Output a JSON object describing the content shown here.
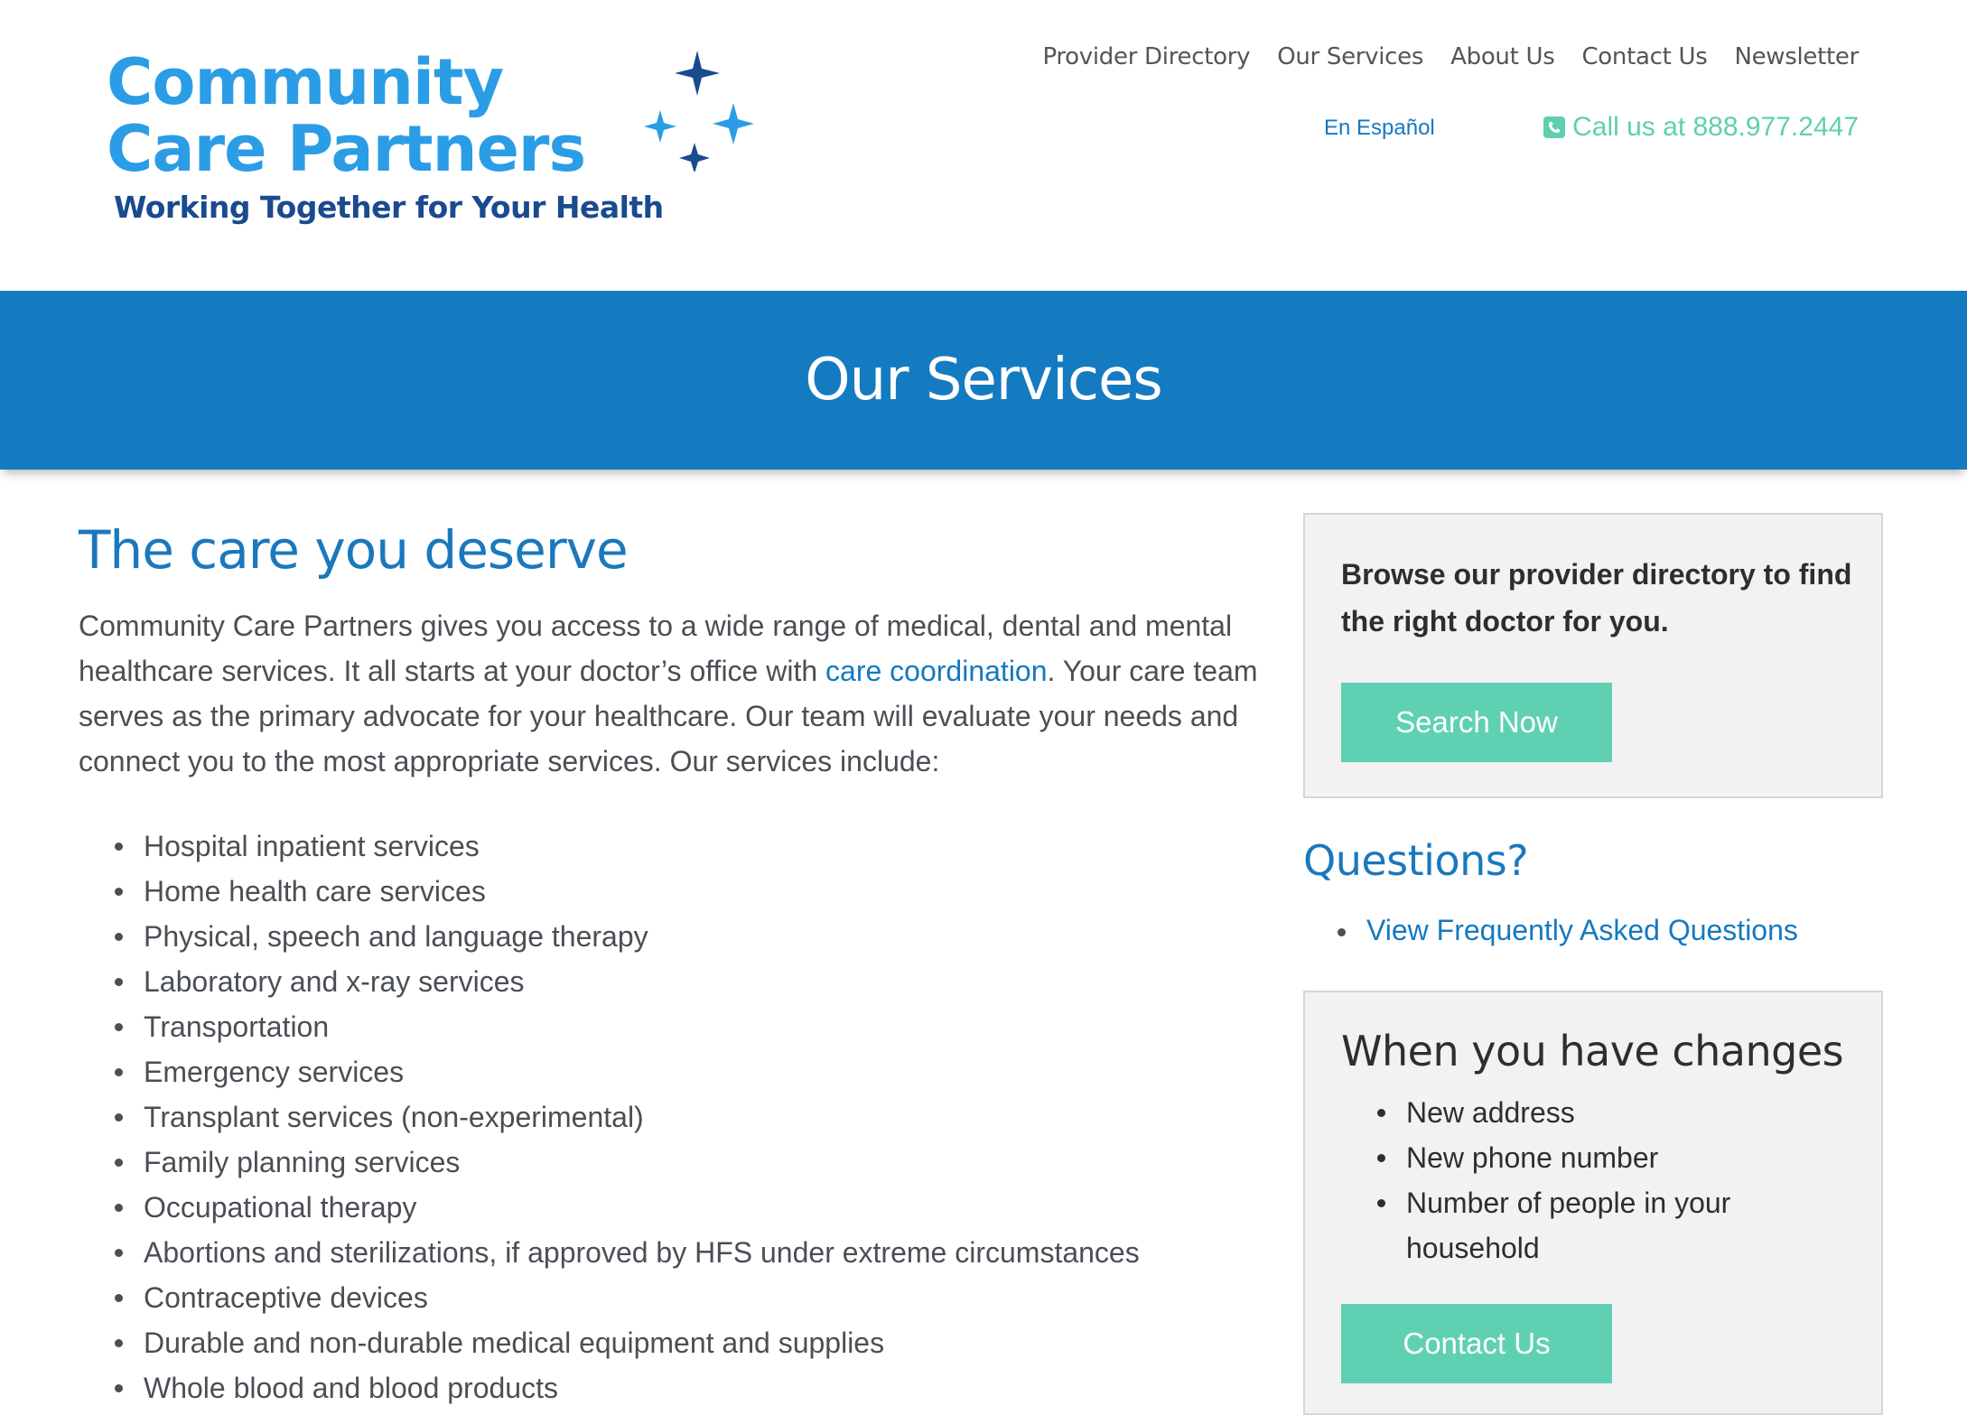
{
  "logo": {
    "line1": "Community",
    "line2": "Care Partners",
    "tagline": "Working Together for Your Health"
  },
  "nav": {
    "items": [
      {
        "label": "Provider Directory"
      },
      {
        "label": "Our Services"
      },
      {
        "label": "About Us"
      },
      {
        "label": "Contact Us"
      },
      {
        "label": "Newsletter"
      }
    ],
    "espanol": "En Español",
    "call": "Call us at 888.977.2447"
  },
  "banner": {
    "title": "Our Services"
  },
  "main": {
    "heading": "The care you deserve",
    "intro_before": "Community Care Partners gives you access to a wide range of medical, dental and mental healthcare services. It all starts at your doctor’s office with ",
    "intro_link": "care coordination",
    "intro_after": ". Your care team serves as the primary advocate for your healthcare. Our team will evaluate your needs and connect you to the most appropriate services. Our services include:",
    "services": [
      "Hospital inpatient services",
      "Home health care services",
      "Physical, speech and language therapy",
      "Laboratory and x-ray services",
      "Transportation",
      "Emergency services",
      "Transplant services (non-experimental)",
      "Family planning services",
      "Occupational therapy",
      "Abortions and sterilizations, if approved by HFS under extreme circumstances",
      "Contraceptive devices",
      "Durable and non-durable medical equipment and supplies",
      "Whole blood and blood products"
    ]
  },
  "sidebar": {
    "directory_text": "Browse our provider directory to find the right doctor for you.",
    "search_button": "Search Now",
    "questions_heading": "Questions?",
    "faq_link": "View Frequently Asked Questions",
    "changes_heading": "When you have changes",
    "changes": [
      "New address",
      "New phone number",
      "Number of people in your household"
    ],
    "contact_button": "Contact Us"
  },
  "colors": {
    "brand_blue": "#147bc1",
    "logo_light_blue": "#2a9de6",
    "logo_navy": "#1a4a8f",
    "accent_green": "#5fd1b2",
    "link_blue": "#1579c0"
  }
}
